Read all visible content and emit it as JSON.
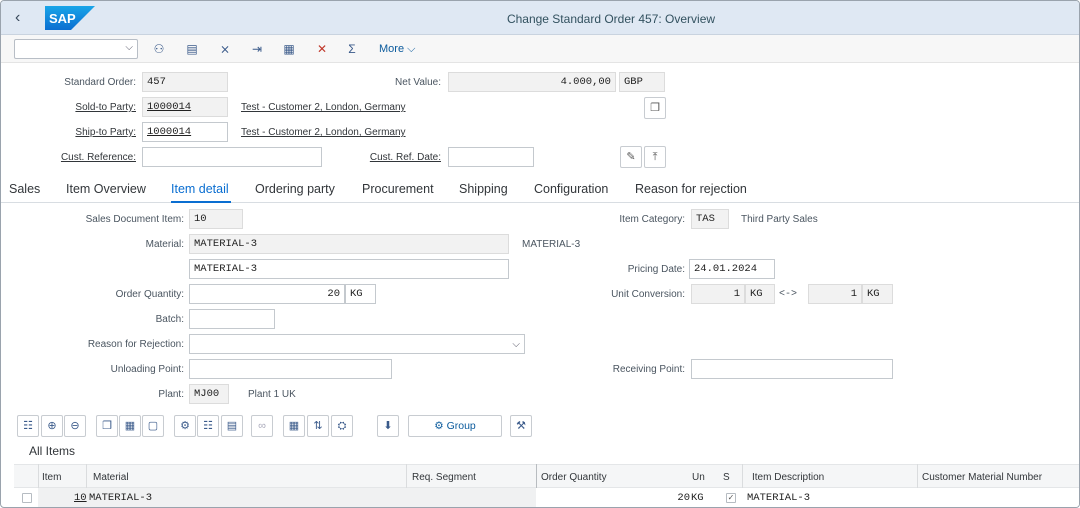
{
  "shell": {
    "title": "Change Standard Order 457: Overview",
    "logo_text": "SAP",
    "brand_color": "#0a6ed1"
  },
  "toolbar": {
    "select_value": "",
    "more_label": "More",
    "icons": [
      "display-icon",
      "document-icon",
      "delete-icon",
      "exit-icon",
      "print-icon",
      "cancel-icon",
      "sum-icon"
    ]
  },
  "header": {
    "standard_order_label": "Standard Order:",
    "standard_order_value": "457",
    "net_value_label": "Net Value:",
    "net_value_value": "4.000,00",
    "currency": "GBP",
    "sold_to_label": "Sold-to Party:",
    "sold_to_value": "1000014",
    "sold_to_desc": "Test - Customer 2, London, Germany",
    "ship_to_label": "Ship-to Party:",
    "ship_to_value": "1000014",
    "ship_to_desc": "Test - Customer 2, London, Germany",
    "cust_ref_label": "Cust. Reference:",
    "cust_ref_value": "",
    "cust_ref_date_label": "Cust. Ref. Date:",
    "cust_ref_date_value": ""
  },
  "tabs": [
    "Sales",
    "Item Overview",
    "Item detail",
    "Ordering party",
    "Procurement",
    "Shipping",
    "Configuration",
    "Reason for rejection"
  ],
  "active_tab": "Item detail",
  "item_detail": {
    "sales_doc_item_label": "Sales Document Item:",
    "sales_doc_item_value": "10",
    "item_category_label": "Item Category:",
    "item_category_value": "TAS",
    "item_category_desc": "Third Party Sales",
    "material_label": "Material:",
    "material_value": "MATERIAL-3",
    "material_desc_right": "MATERIAL-3",
    "material_desc_field": "MATERIAL-3",
    "pricing_date_label": "Pricing Date:",
    "pricing_date_value": "24.01.2024",
    "order_qty_label": "Order Quantity:",
    "order_qty_value": "20",
    "order_qty_unit": "KG",
    "unit_conv_label": "Unit Conversion:",
    "unit_conv_left_value": "1",
    "unit_conv_left_unit": "KG",
    "unit_conv_arrow": "<->",
    "unit_conv_right_value": "1",
    "unit_conv_right_unit": "KG",
    "batch_label": "Batch:",
    "batch_value": "",
    "reason_rejection_label": "Reason for Rejection:",
    "reason_rejection_value": "",
    "unloading_point_label": "Unloading Point:",
    "unloading_point_value": "",
    "receiving_point_label": "Receiving Point:",
    "receiving_point_value": "",
    "plant_label": "Plant:",
    "plant_value": "MJ00",
    "plant_desc": "Plant 1 UK"
  },
  "table_toolbar": {
    "group_label": "Group"
  },
  "items_table": {
    "title": "All Items",
    "columns": {
      "item": "Item",
      "material": "Material",
      "req_segment": "Req. Segment",
      "order_quantity": "Order Quantity",
      "un": "Un",
      "s": "S",
      "item_description": "Item Description",
      "customer_material_number": "Customer Material Number"
    },
    "rows": [
      {
        "item": "10",
        "material": "MATERIAL-3",
        "req_segment": "",
        "order_quantity": "20",
        "un": "KG",
        "s_checked": true,
        "item_description": "MATERIAL-3",
        "customer_material_number": ""
      }
    ]
  }
}
